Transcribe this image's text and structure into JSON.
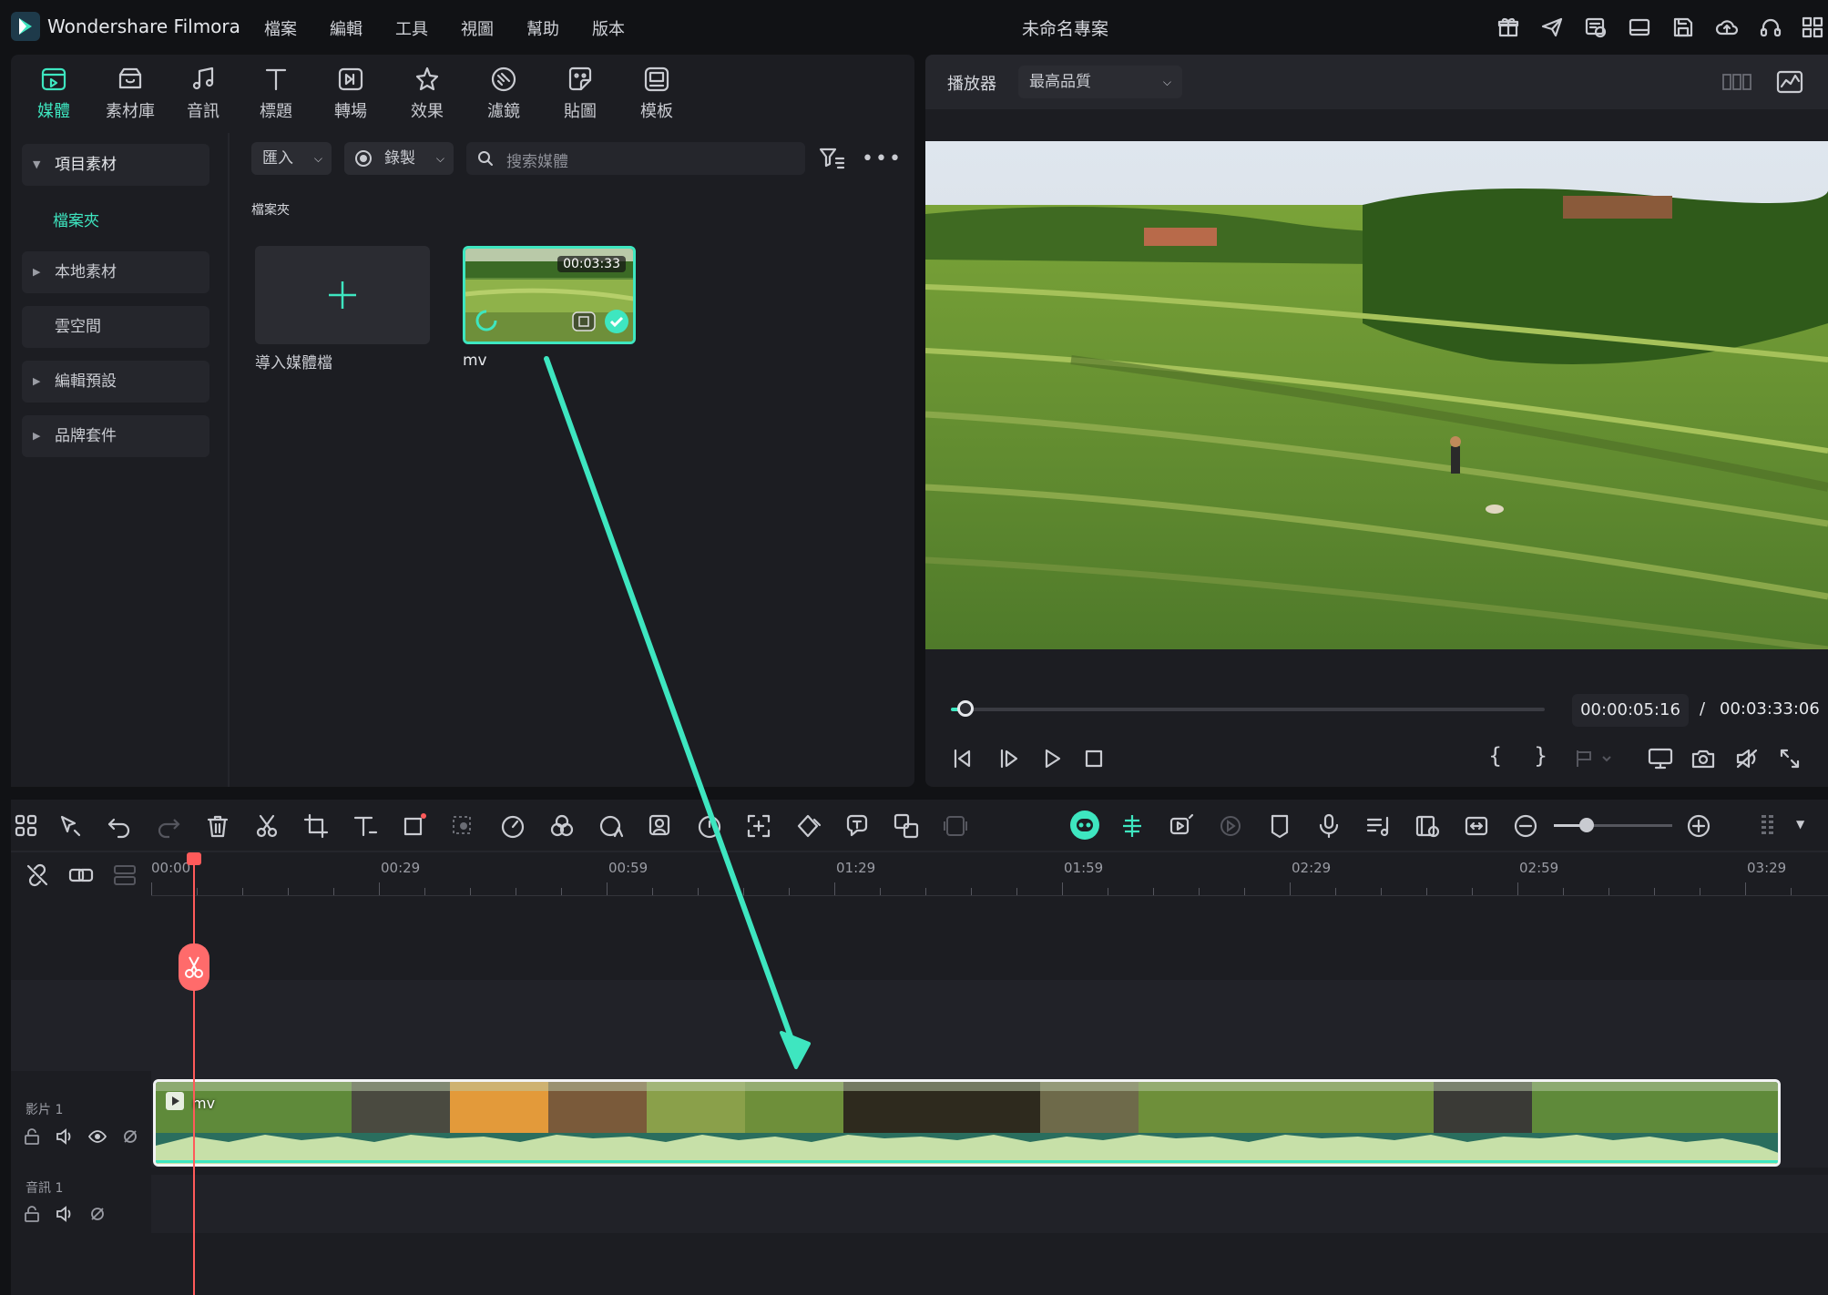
{
  "app": {
    "name": "Wondershare Filmora",
    "project_title": "未命名專案"
  },
  "menu": [
    "檔案",
    "編輯",
    "工具",
    "視圖",
    "幫助",
    "版本"
  ],
  "categories": [
    {
      "label": "媒體",
      "icon": "media-icon",
      "active": true
    },
    {
      "label": "素材庫",
      "icon": "library-icon"
    },
    {
      "label": "音訊",
      "icon": "music-icon"
    },
    {
      "label": "標題",
      "icon": "title-icon"
    },
    {
      "label": "轉場",
      "icon": "transition-icon"
    },
    {
      "label": "效果",
      "icon": "effects-icon"
    },
    {
      "label": "濾鏡",
      "icon": "filter-icon"
    },
    {
      "label": "貼圖",
      "icon": "sticker-icon"
    },
    {
      "label": "模板",
      "icon": "template-icon"
    }
  ],
  "sidebar": {
    "project_media": "項目素材",
    "folder": "檔案夾",
    "local_media": "本地素材",
    "cloud": "雲空間",
    "edit_presets": "編輯預設",
    "brand_kit": "品牌套件"
  },
  "media_toolbar": {
    "import": "匯入",
    "record": "錄製",
    "search_placeholder": "搜索媒體"
  },
  "media_area": {
    "folder_label": "檔案夾",
    "import_label": "導入媒體檔",
    "clip": {
      "name": "mv",
      "duration": "00:03:33"
    }
  },
  "player": {
    "label": "播放器",
    "quality": "最高品質",
    "current_time": "00:00:05:16",
    "separator": "/",
    "total_time": "00:03:33:06",
    "progress": 0.025
  },
  "timeline": {
    "ruler_labels": [
      "00:00",
      "00:29",
      "00:59",
      "01:29",
      "01:59",
      "02:29",
      "02:59",
      "03:29"
    ],
    "video_track_label": "影片 1",
    "audio_track_label": "音訊 1",
    "clip_name": "mv"
  },
  "colors": {
    "accent": "#3ee6c0",
    "playhead": "#ff5a5a",
    "bg": "#1c1d22"
  }
}
